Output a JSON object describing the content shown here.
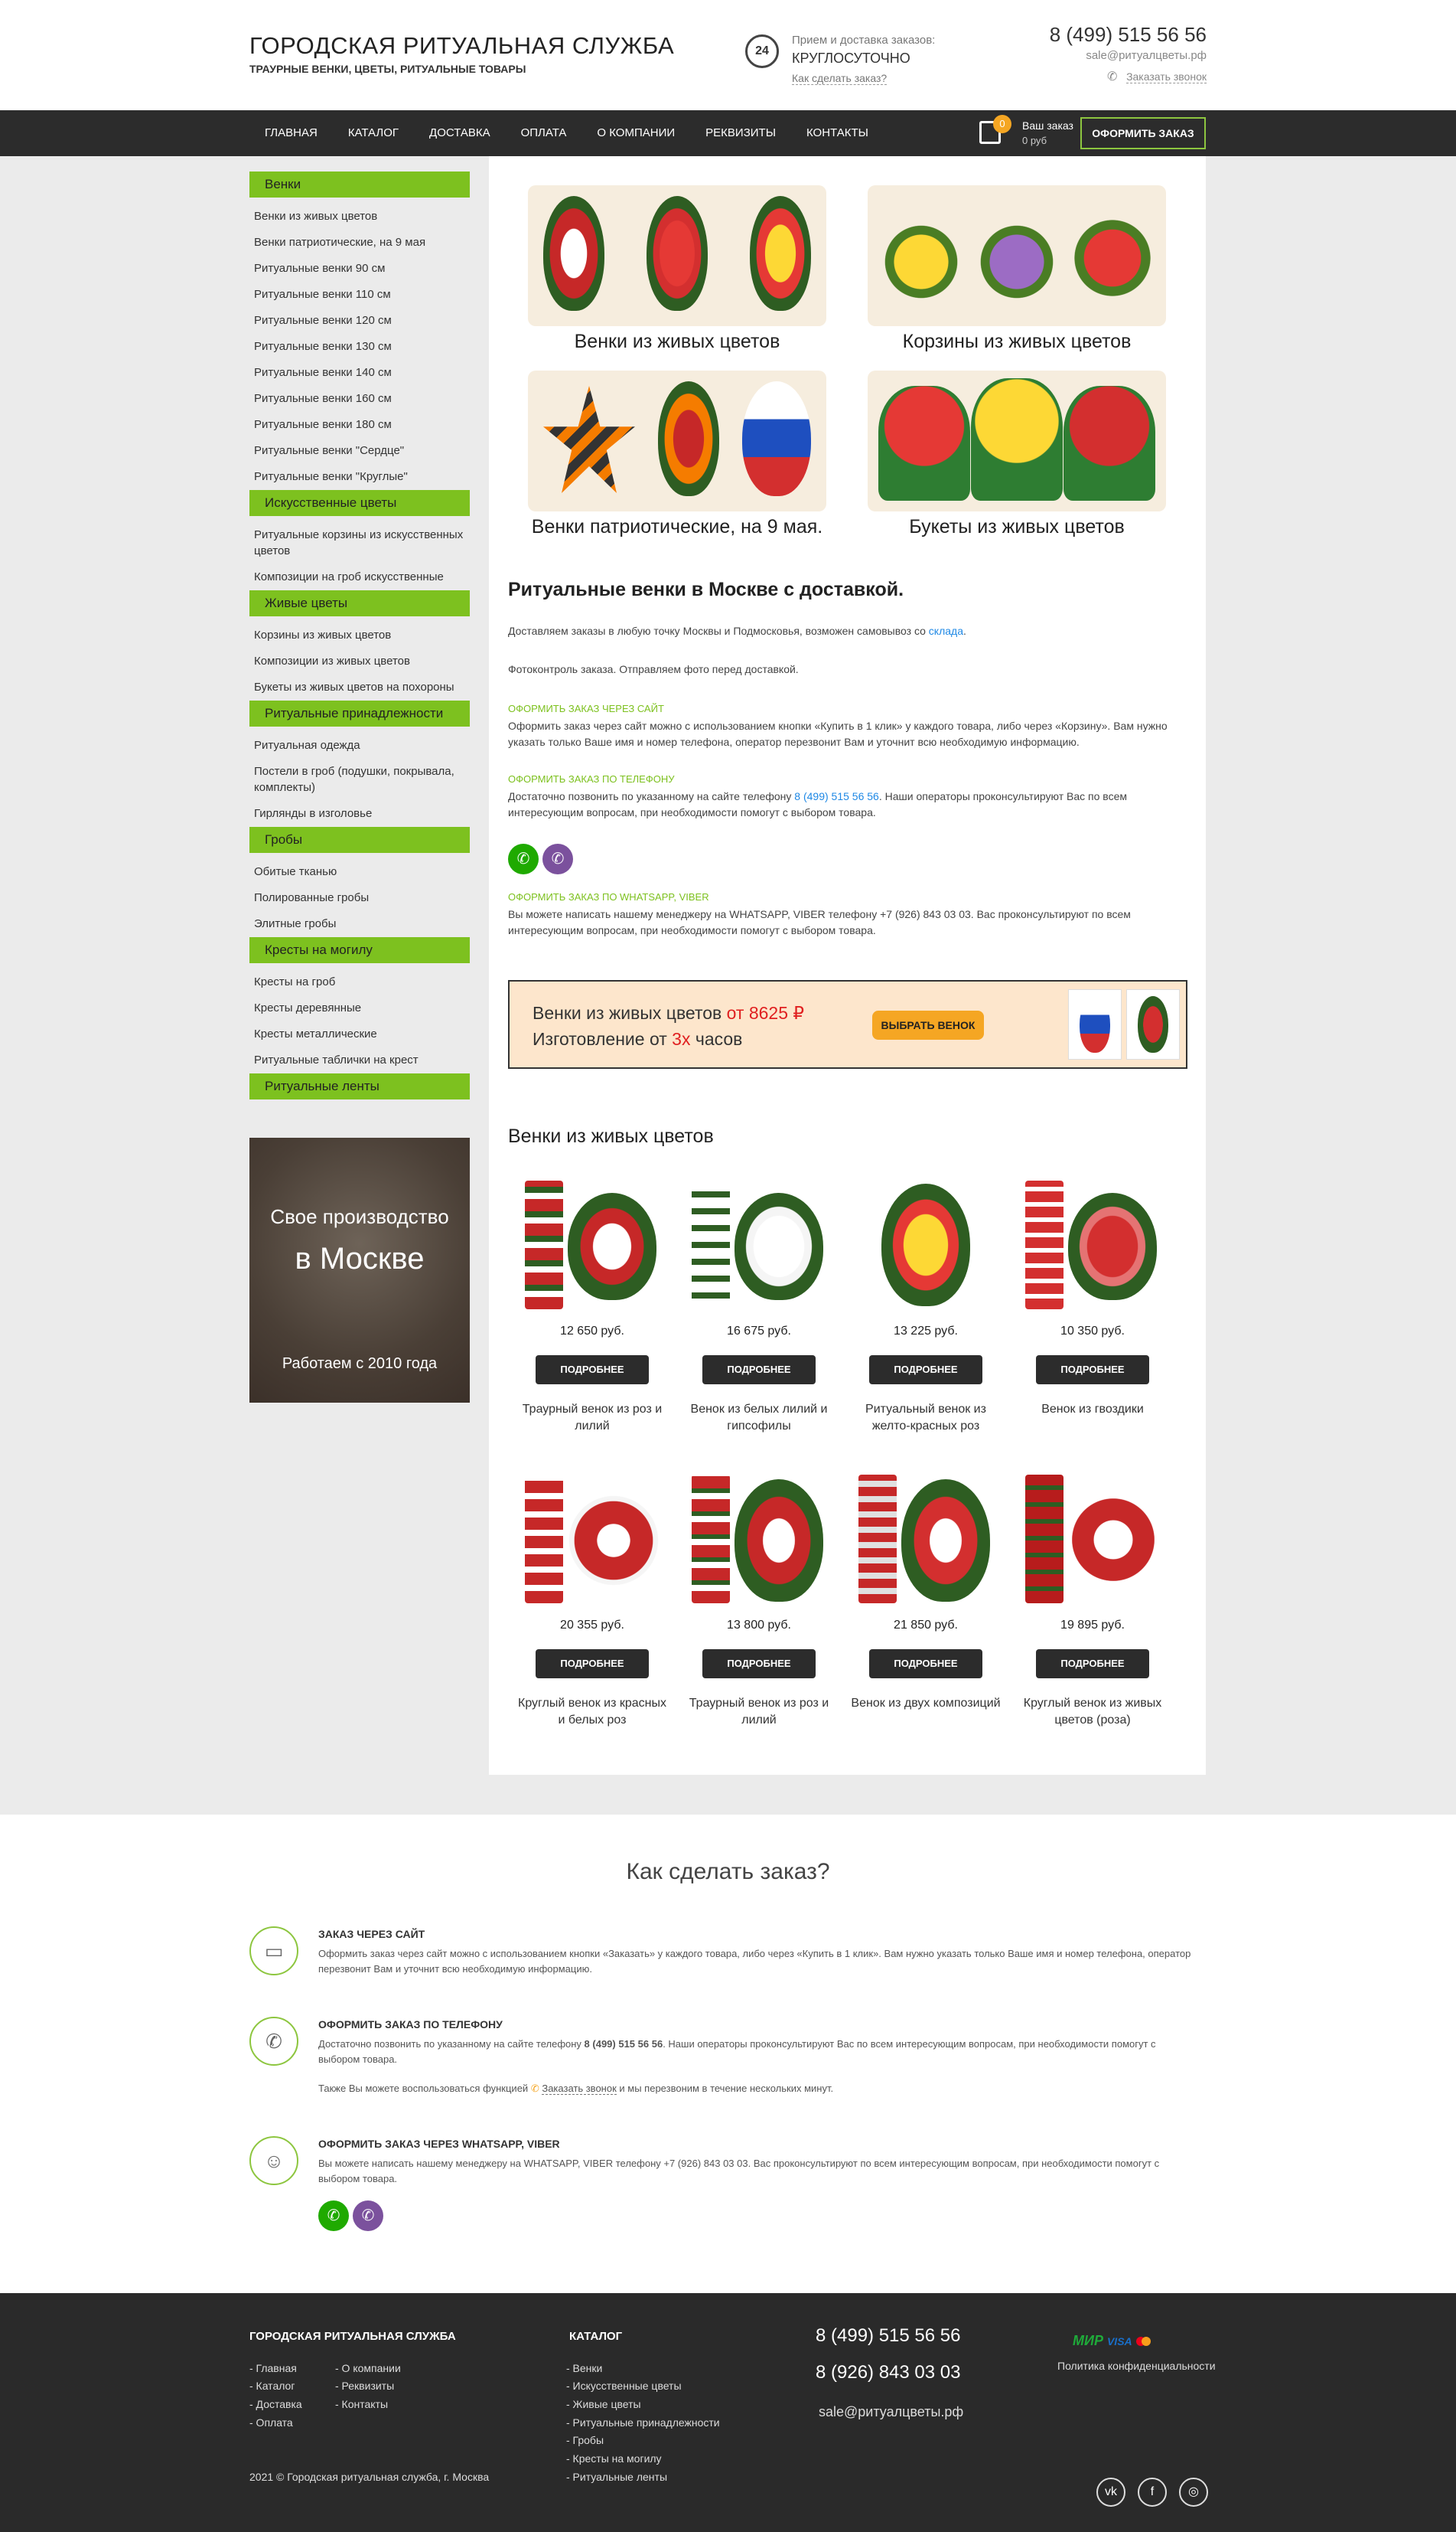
{
  "header": {
    "title": "ГОРОДСКАЯ РИТУАЛЬНАЯ СЛУЖБА",
    "subtitle": "ТРАУРНЫЕ ВЕНКИ, ЦВЕТЫ, РИТУАЛЬНЫЕ ТОВАРЫ",
    "clock_label": "24",
    "order_hours_label": "Прием и доставка заказов:",
    "order_hours_value": "КРУГЛОСУТОЧНО",
    "how_to_order_link": "Как сделать заказ?",
    "phone": "8 (499) 515 56 56",
    "email": "sale@ритуалцветы.рф",
    "callback_link": "Заказать звонок"
  },
  "nav": {
    "items": [
      "ГЛАВНАЯ",
      "КАТАЛОГ",
      "ДОСТАВКА",
      "ОПЛАТА",
      "О КОМПАНИИ",
      "РЕКВИЗИТЫ",
      "КОНТАКТЫ"
    ],
    "cart_count": "0",
    "cart_label": "Ваш заказ",
    "cart_sum": "0 руб",
    "checkout": "ОФОРМИТЬ ЗАКАЗ"
  },
  "sidebar": {
    "cat1": "Венки",
    "cat1_items": [
      "Венки из живых цветов",
      "Венки патриотические, на 9 мая",
      "Ритуальные венки 90 см",
      "Ритуальные венки 110 см",
      "Ритуальные венки 120 см",
      "Ритуальные венки 130 см",
      "Ритуальные венки 140 см",
      "Ритуальные венки 160 см",
      "Ритуальные венки 180 см",
      "Ритуальные венки \"Сердце\"",
      "Ритуальные венки \"Круглые\""
    ],
    "cat2": "Искусственные цветы",
    "cat2_items": [
      "Ритуальные корзины из искусственных цветов",
      "Композиции на гроб искусственные"
    ],
    "cat3": "Живые цветы",
    "cat3_items": [
      "Корзины из живых цветов",
      "Композиции из живых цветов",
      "Букеты из живых цветов на похороны"
    ],
    "cat4": "Ритуальные принадлежности",
    "cat4_items": [
      "Ритуальная одежда",
      "Постели в гроб (подушки, покрывала, комплекты)",
      "Гирлянды в изголовье"
    ],
    "cat5": "Гробы",
    "cat5_items": [
      "Обитые тканью",
      "Полированные гробы",
      "Элитные гробы"
    ],
    "cat6": "Кресты на могилу",
    "cat6_items": [
      "Кресты на гроб",
      "Кресты деревянные",
      "Кресты металлические",
      "Ритуальные таблички на крест"
    ],
    "cat7": "Ритуальные ленты",
    "promo_line1": "Свое производство",
    "promo_line2": "в Москве",
    "promo_line3": "Работаем с 2010 года"
  },
  "tiles": {
    "t1": "Венки из живых цветов",
    "t2": "Корзины из живых цветов",
    "t3": "Венки патриотические, на 9 мая.",
    "t4": "Букеты из живых цветов"
  },
  "intro": {
    "heading": "Ритуальные венки в Москве с доставкой.",
    "p1_start": "Доставляем заказы в любую точку Москвы и Подмосковья, возможен самовывоз со",
    "p1_link": "склада",
    "p1_end": ".",
    "p2": "Фотоконтроль заказа. Отправляем фото перед доставкой.",
    "site_title": "ОФОРМИТЬ ЗАКАЗ ЧЕРЕЗ САЙТ",
    "site_text": "Оформить заказ через сайт можно с использованием кнопки «Купить в 1 клик» у каждого товара, либо через «Корзину». Вам нужно указать только Ваше имя и номер телефона, оператор перезвонит Вам и уточнит всю необходимую информацию.",
    "phone_title": "ОФОРМИТЬ ЗАКАЗ ПО ТЕЛЕФОНУ",
    "phone_text_start": "Достаточно позвонить по указанному на сайте телефону",
    "phone_text_link": "8 (499) 515 56 56",
    "phone_text_end": ". Наши операторы проконсультируют Вас по всем интересующим вопросам, при необходимости помогут с выбором товара.",
    "wa_title": "ОФОРМИТЬ ЗАКАЗ ПО WHATSAPP, VIBER",
    "wa_text": "Вы можете написать нашему менеджеру на WHATSAPP, VIBER телефону +7 (926) 843 03 03. Вас проконсультируют по всем интересующим вопросам, при необходимости помогут с выбором товара."
  },
  "banner": {
    "line1_text": "Венки из живых цветов ",
    "line1_price": "от 8625 ₽",
    "line2_text": "Изготовление от ",
    "line2_hours": "3х",
    "line2_end": " часов",
    "button": "ВЫБРАТЬ ВЕНОК"
  },
  "products": {
    "heading": "Венки из живых цветов",
    "button_label": "ПОДРОБНЕЕ",
    "items": [
      {
        "price": "12 650 руб.",
        "name": "Траурный венок из роз и лилий"
      },
      {
        "price": "16 675 руб.",
        "name": "Венок из белых лилий и гипсофилы"
      },
      {
        "price": "13 225 руб.",
        "name": "Ритуальный венок из желто-красных роз"
      },
      {
        "price": "10 350 руб.",
        "name": "Венок из гвоздики"
      },
      {
        "price": "20 355 руб.",
        "name": "Круглый венок из красных и белых роз"
      },
      {
        "price": "13 800 руб.",
        "name": "Траурный венок из роз и лилий"
      },
      {
        "price": "21 850 руб.",
        "name": "Венок из двух композиций"
      },
      {
        "price": "19 895 руб.",
        "name": "Круглый венок из живых цветов (роза)"
      }
    ]
  },
  "howto": {
    "title": "Как сделать заказ?",
    "s1_title": "ЗАКАЗ ЧЕРЕЗ САЙТ",
    "s1_text": "Оформить заказ через сайт можно с использованием кнопки «Заказать» у каждого товара, либо через «Купить в 1 клик». Вам нужно указать только Ваше имя и номер телефона, оператор перезвонит Вам и уточнит всю необходимую информацию.",
    "s2_title": "ОФОРМИТЬ ЗАКАЗ ПО ТЕЛЕФОНУ",
    "s2_text_start": "Достаточно позвонить по указанному на сайте телефону ",
    "s2_phone": "8 (499) 515 56 56",
    "s2_text_end": ". Наши операторы проконсультируют Вас по всем интересующим вопросам, при необходимости помогут с выбором товара.",
    "s2_extra_start": "Также Вы можете воспользоваться функцией",
    "s2_extra_link": "Заказать звонок",
    "s2_extra_end": "и мы перезвоним в течение нескольких минут.",
    "s3_title": "ОФОРМИТЬ ЗАКАЗ ЧЕРЕЗ WHATSAPP, VIBER",
    "s3_text": "Вы можете написать нашему менеджеру на WHATSAPP, VIBER телефону +7 (926) 843 03 03. Вас проконсультируют по всем интересующим вопросам, при необходимости помогут с выбором товара."
  },
  "footer": {
    "col1_title": "ГОРОДСКАЯ РИТУАЛЬНАЯ СЛУЖБА",
    "col1_links_a": [
      "- Главная",
      "- Каталог",
      "- Доставка",
      "- Оплата"
    ],
    "col1_links_b": [
      "- О компании",
      "- Реквизиты",
      "- Контакты"
    ],
    "col2_title": "КАТАЛОГ",
    "col2_links": [
      "- Венки",
      "- Искусственные цветы",
      "- Живые цветы",
      "- Ритуальные принадлежности",
      "- Гробы",
      "- Кресты на могилу",
      "- Ритуальные ленты"
    ],
    "phone1": "8 (499) 515 56 56",
    "phone2": "8 (926) 843 03 03",
    "email": "sale@ритуалцветы.рф",
    "pay_mir": "МИР",
    "pay_visa": "VISA",
    "policy": "Политика конфиденциальности",
    "copyright": "2021 © Городская ритуальная служба, г. Москва"
  },
  "colors": {
    "accent_green": "#7dc11f",
    "nav_dark": "#2c2c2c",
    "orange": "#f5a623",
    "link_blue": "#1e88e5",
    "price_red": "#e02020"
  },
  "icons": [
    "clock-24-icon",
    "phone-callback-icon",
    "cart-icon",
    "whatsapp-icon",
    "viber-icon",
    "browser-icon",
    "phone-icon",
    "users-icon",
    "vk-icon",
    "facebook-icon",
    "instagram-icon"
  ]
}
